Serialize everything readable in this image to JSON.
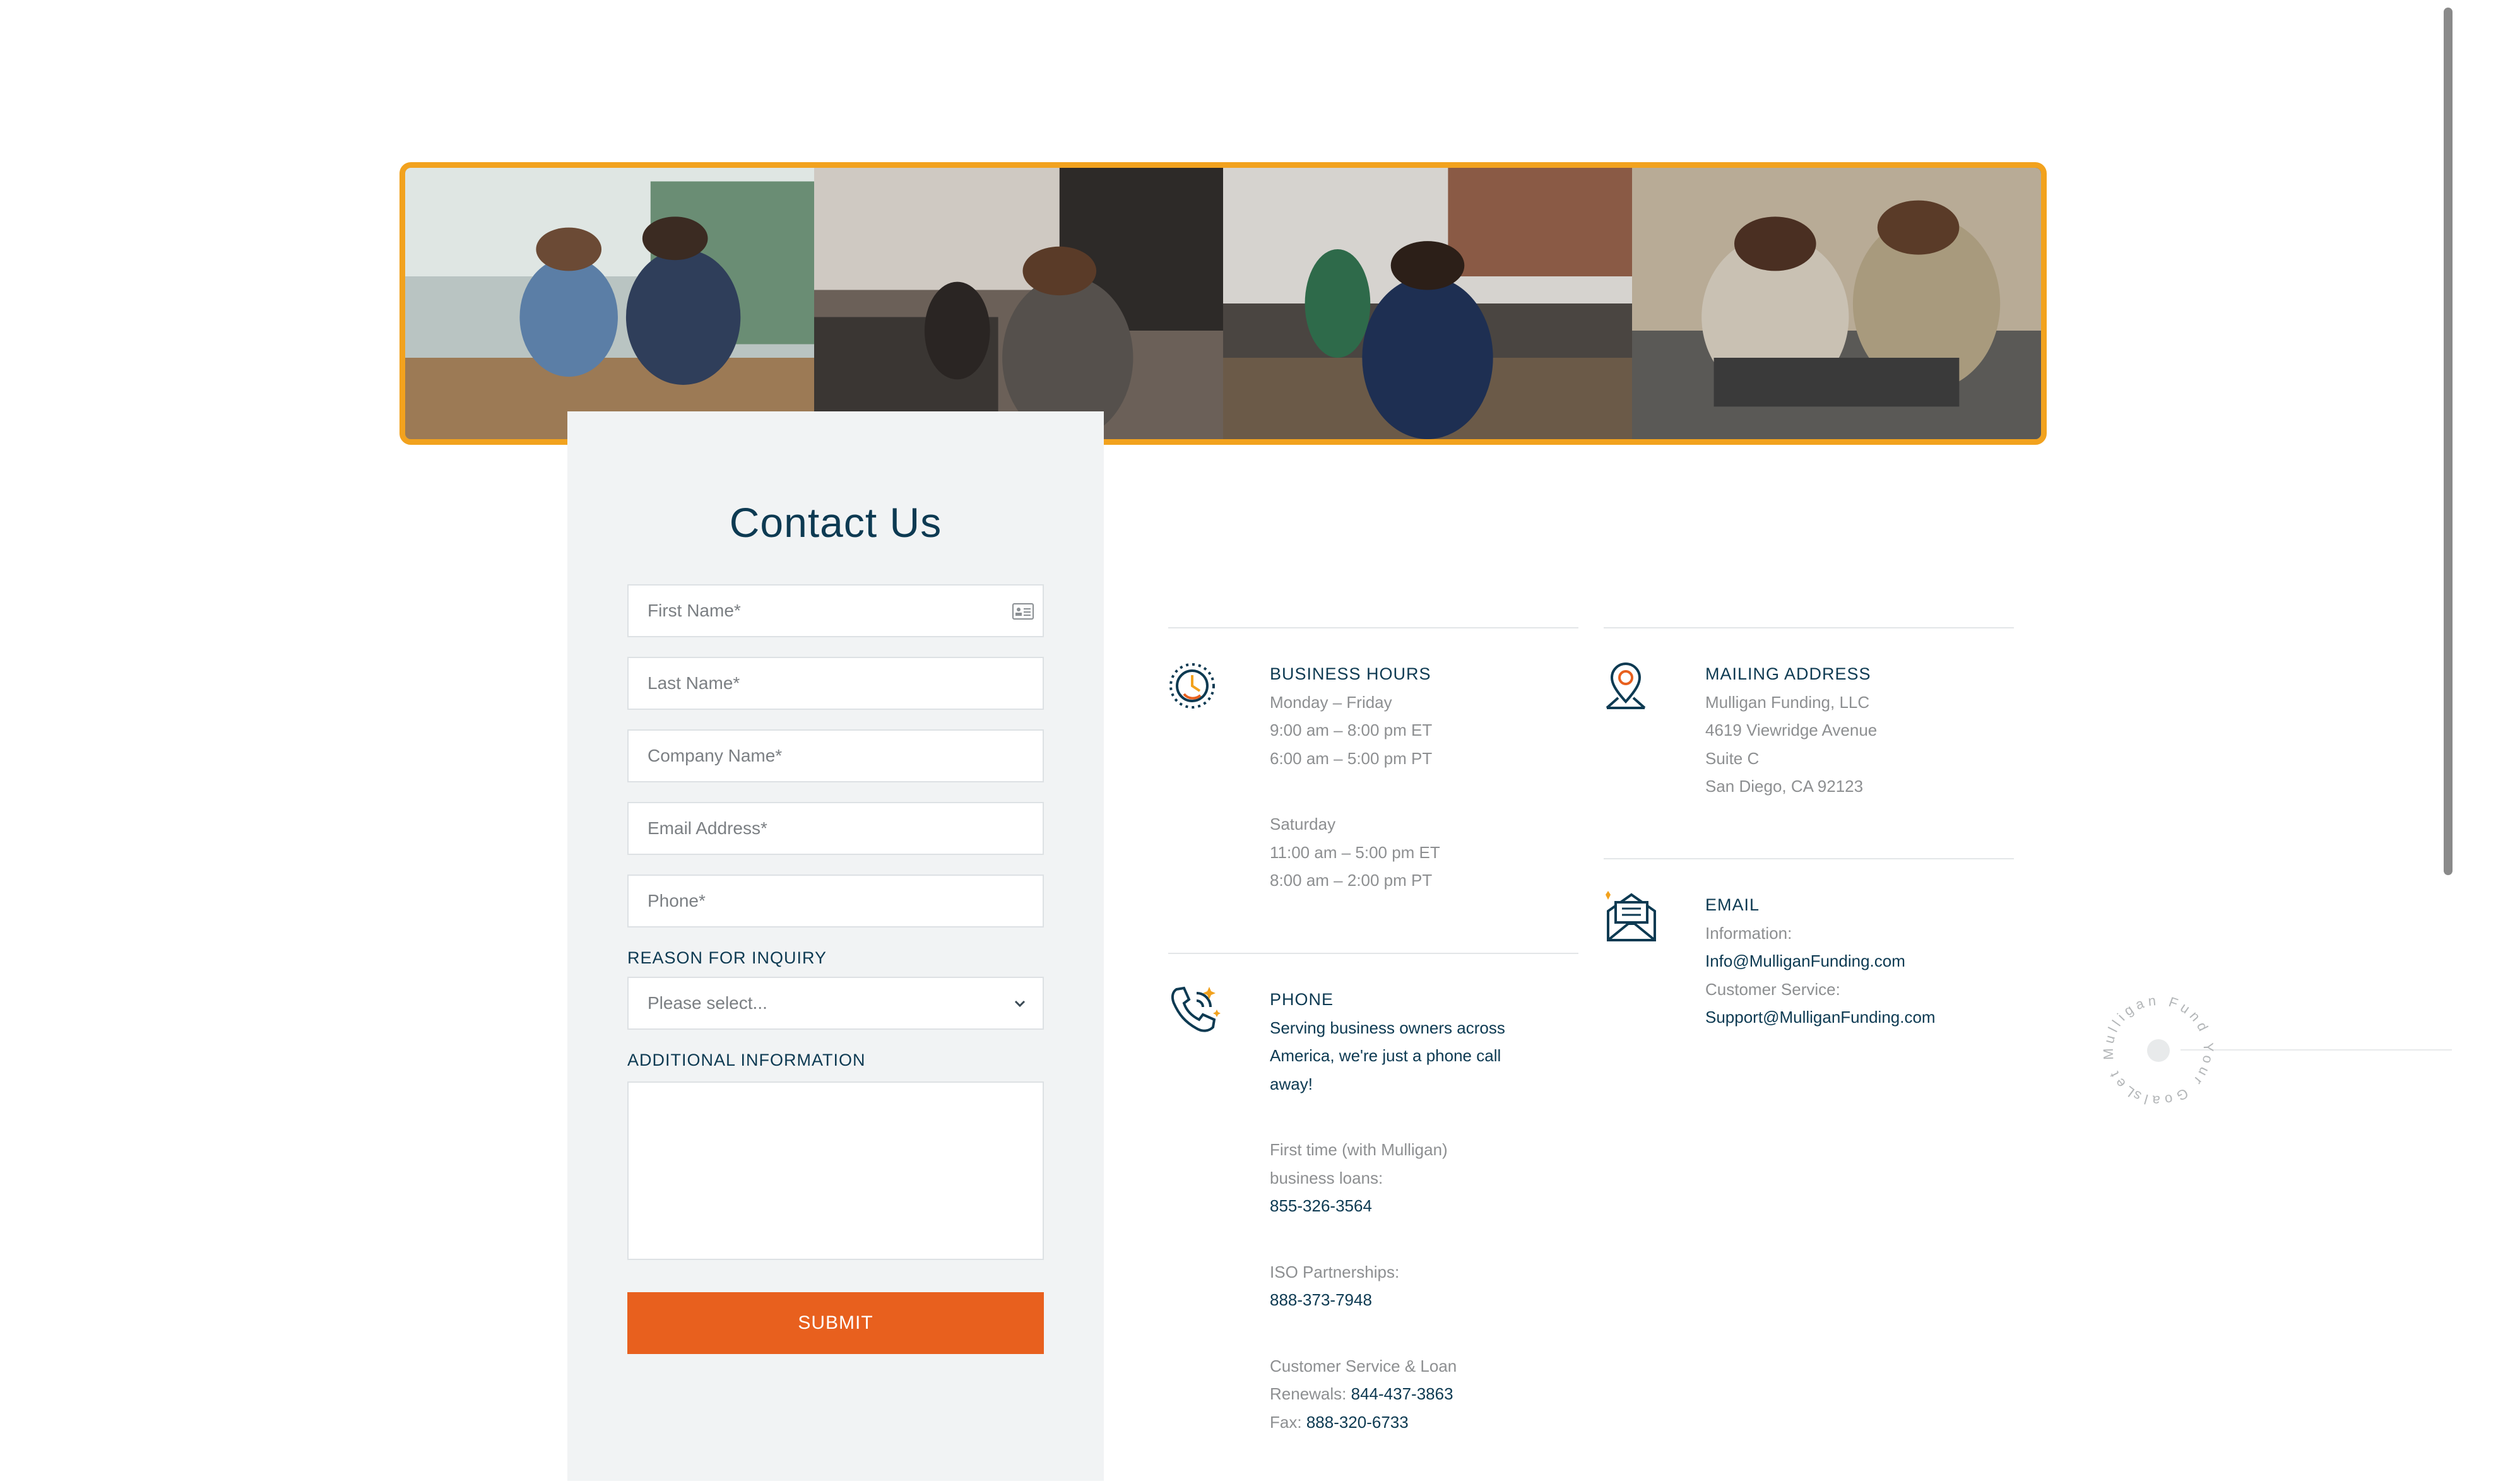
{
  "form": {
    "title": "Contact Us",
    "fields": {
      "first_name": "First Name*",
      "last_name": "Last Name*",
      "company_name": "Company Name*",
      "email": "Email Address*",
      "phone": "Phone*"
    },
    "reason_label": "REASON FOR INQUIRY",
    "reason_placeholder": "Please select...",
    "additional_label": "ADDITIONAL INFORMATION",
    "submit_label": "SUBMIT"
  },
  "hours": {
    "heading": "BUSINESS HOURS",
    "weekday": "Monday – Friday",
    "weekday_et": "9:00 am – 8:00 pm ET",
    "weekday_pt": "6:00 am – 5:00 pm PT",
    "saturday": "Saturday",
    "saturday_et": "11:00 am – 5:00 pm ET",
    "saturday_pt": "8:00 am – 2:00 pm PT"
  },
  "phone": {
    "heading": "PHONE",
    "tagline_1": "Serving business owners across",
    "tagline_2": "America, we're just a phone call",
    "tagline_3": "away!",
    "first_time_1": "First time (with Mulligan)",
    "first_time_2": "business loans:",
    "first_time_number": "855-326-3564",
    "iso_label": "ISO Partnerships:",
    "iso_number": "888-373-7948",
    "cs_label_1": "Customer Service & Loan",
    "cs_label_2": "Renewals:",
    "cs_number": "844-437-3863",
    "fax_label": "Fax:",
    "fax_number": "888-320-6733"
  },
  "mailing": {
    "heading": "MAILING ADDRESS",
    "company": "Mulligan Funding, LLC",
    "street": "4619 Viewridge Avenue",
    "suite": "Suite C",
    "city": "San Diego, CA 92123"
  },
  "email": {
    "heading": "EMAIL",
    "info_label": "Information:",
    "info_address": "Info@MulliganFunding.com",
    "cs_label": "Customer Service:",
    "cs_address": "Support@MulliganFunding.com"
  },
  "badge": {
    "text": "Let Mulligan Fund Your Goals"
  },
  "colors": {
    "accent_orange": "#e8601e",
    "banner_border": "#f2a21e",
    "navy": "#0d3a52",
    "muted_gray": "#8d8f91",
    "form_bg": "#f1f3f4"
  },
  "icons": {
    "hours": "clock-icon",
    "mailing": "location-pin-icon",
    "phone": "phone-icon",
    "email": "envelope-icon",
    "first_name": "contact-card-icon",
    "select": "chevron-down-icon"
  }
}
